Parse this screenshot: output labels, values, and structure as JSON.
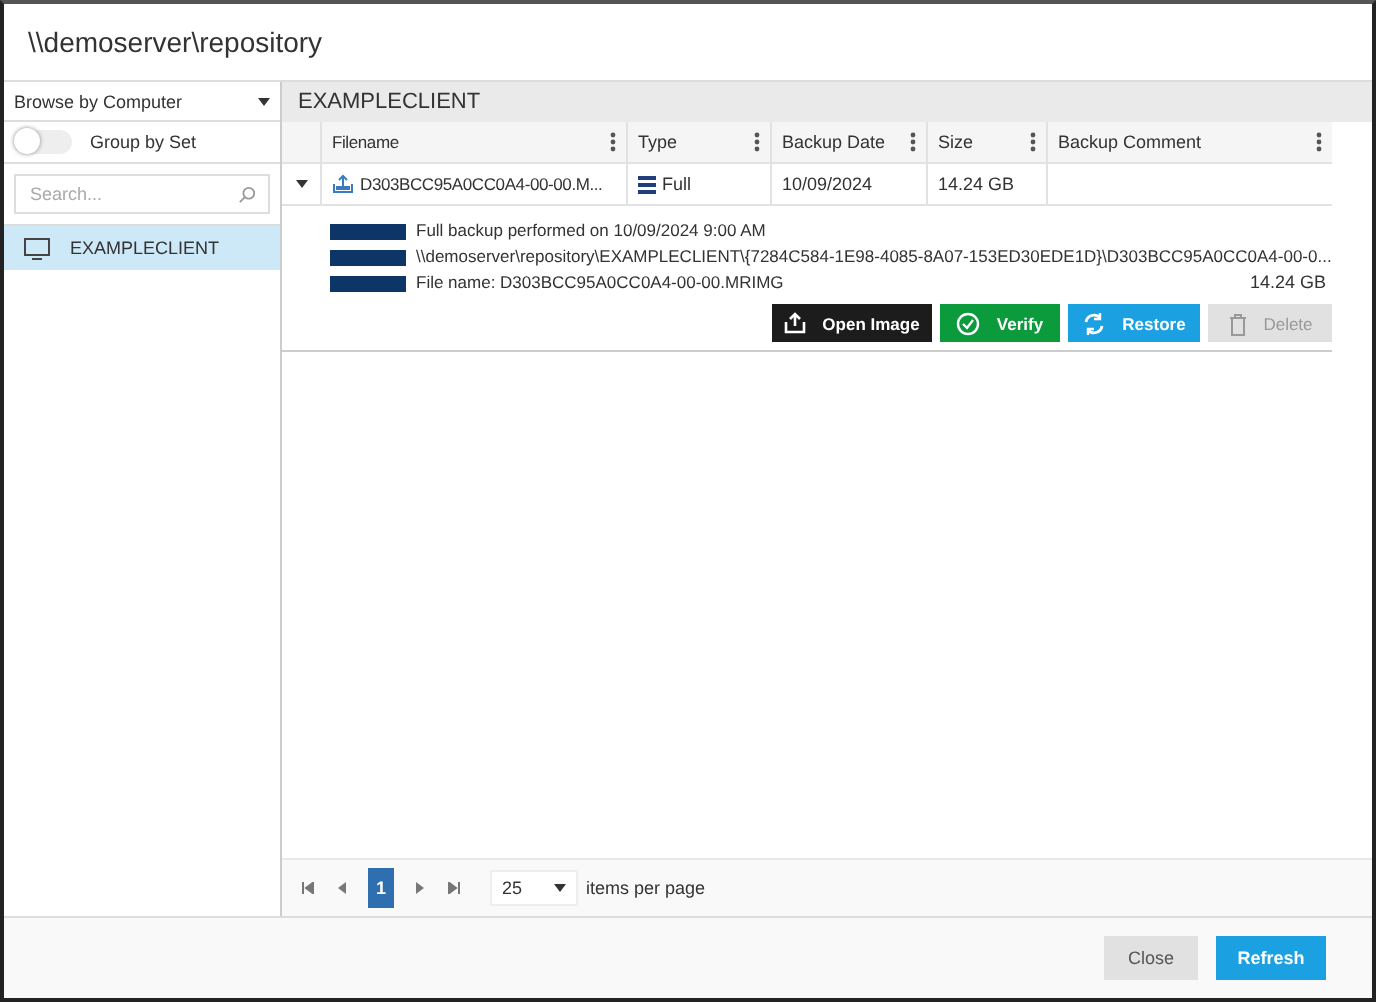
{
  "window": {
    "title": "\\\\demoserver\\repository"
  },
  "sidebar": {
    "browse_by": "Browse by Computer",
    "group_by_set": {
      "label": "Group by Set",
      "on": false
    },
    "search": {
      "placeholder": "Search..."
    },
    "items": [
      {
        "label": "EXAMPLECLIENT",
        "selected": true
      }
    ]
  },
  "panel": {
    "title": "EXAMPLECLIENT",
    "table": {
      "columns": [
        "Filename",
        "Type",
        "Backup Date",
        "Size",
        "Backup Comment"
      ],
      "rows": [
        {
          "expanded": true,
          "filename": "D303BCC95A0CC0A4-00-00.M...",
          "type": "Full",
          "date": "10/09/2024",
          "size": "14.24 GB",
          "details": {
            "lines": [
              "Full backup performed on 10/09/2024 9:00 AM",
              "\\\\demoserver\\repository\\EXAMPLECLIENT\\{7284C584-1E98-4085-8A07-153ED30EDE1D}\\D303BCC95A0CC0A4-00-0...",
              "File name: D303BCC95A0CC0A4-00-00.MRIMG"
            ],
            "size": "14.24 GB",
            "actions": [
              {
                "label": "Open Image",
                "kind": "open",
                "disabled": false
              },
              {
                "label": "Verify",
                "kind": "verify",
                "disabled": false
              },
              {
                "label": "Restore",
                "kind": "restore",
                "disabled": false
              },
              {
                "label": "Delete",
                "kind": "delete",
                "disabled": true
              }
            ]
          }
        }
      ]
    },
    "pager": {
      "pages": [
        {
          "label": "1",
          "selected": true
        }
      ],
      "page_size": "25",
      "per_page_label": "items per page"
    }
  },
  "buttons": [
    {
      "label": "Close",
      "kind": "secondary"
    },
    {
      "label": "Refresh",
      "kind": "primary"
    }
  ]
}
